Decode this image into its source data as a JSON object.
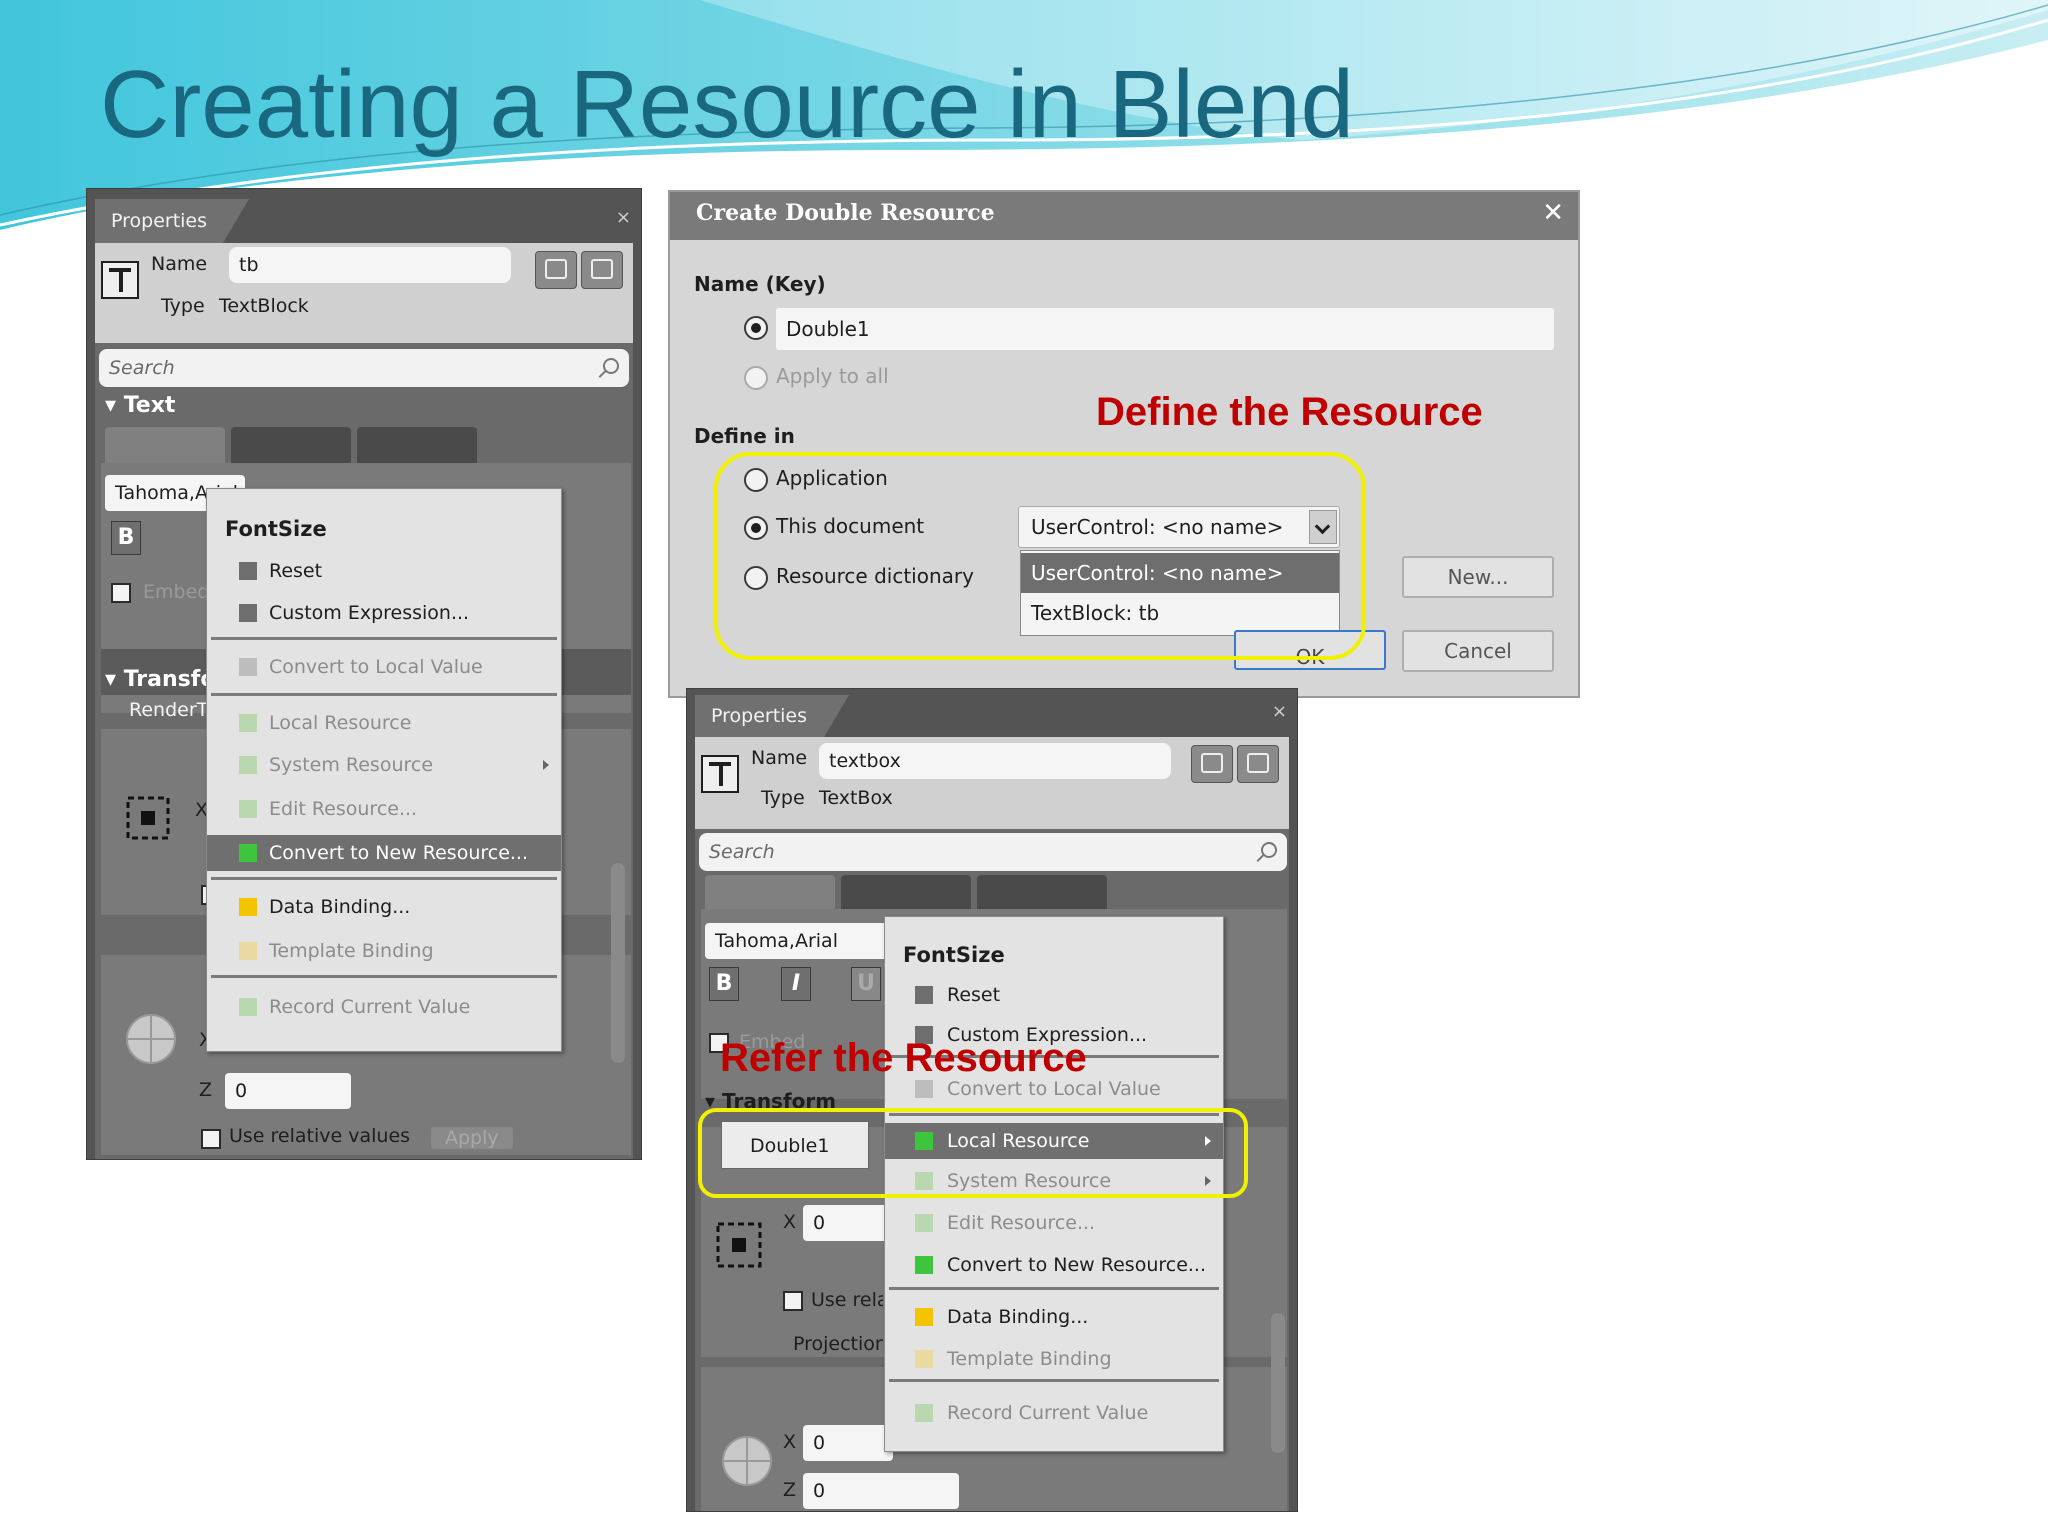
{
  "slide": {
    "title": "Creating a Resource in Blend"
  },
  "panel_left": {
    "tab": "Properties",
    "close": "×",
    "name_label": "Name",
    "name_value": "tb",
    "type_label": "Type",
    "type_value": "TextBlock",
    "search_placeholder": "Search",
    "section_text": "Text",
    "font_value": "Tahoma,Arial",
    "bold": "B",
    "embed": "Embed",
    "section_transform": "Transform",
    "render_label": "RenderTransform",
    "x_label": "X",
    "z_label": "Z",
    "z_value": "0",
    "use_relative": "Use relative values",
    "apply": "Apply"
  },
  "menu_left": {
    "header": "FontSize",
    "items": [
      {
        "label": "Reset",
        "color": "#6e6e6e",
        "enabled": true
      },
      {
        "label": "Custom Expression...",
        "color": "#6e6e6e",
        "enabled": true
      },
      {
        "label": "Convert to Local Value",
        "color": "#bdbdbd",
        "enabled": false
      },
      {
        "label": "Local Resource",
        "color": "#b9d8b0",
        "enabled": false
      },
      {
        "label": "System Resource",
        "color": "#b9d8b0",
        "enabled": false
      },
      {
        "label": "Edit Resource...",
        "color": "#b9d8b0",
        "enabled": false
      },
      {
        "label": "Convert to New Resource...",
        "color": "#3ec53e",
        "enabled": true
      },
      {
        "label": "Data Binding...",
        "color": "#f5c400",
        "enabled": true
      },
      {
        "label": "Template Binding",
        "color": "#ead9a0",
        "enabled": false
      },
      {
        "label": "Record Current Value",
        "color": "#b9d8b0",
        "enabled": false
      }
    ]
  },
  "dialog": {
    "title": "Create Double Resource",
    "close": "✕",
    "name_key_label": "Name (Key)",
    "name_value": "Double1",
    "apply_to_all": "Apply to all",
    "define_in_label": "Define in",
    "opt_application": "Application",
    "opt_this_document": "This document",
    "opt_resource_dictionary": "Resource dictionary",
    "combo_value": "UserControl: <no name>",
    "dropdown_items": [
      "UserControl: <no name>",
      "TextBlock: tb"
    ],
    "new_button": "New...",
    "ok_button": "OK",
    "cancel_button": "Cancel"
  },
  "annotations": {
    "define": "Define the Resource",
    "refer": "Refer the Resource",
    "color": "#c00000",
    "ring_color": "#f0f000"
  },
  "panel_right": {
    "tab": "Properties",
    "close": "×",
    "name_label": "Name",
    "name_value": "textbox",
    "type_label": "Type",
    "type_value": "TextBox",
    "search_placeholder": "Search",
    "font_value": "Tahoma,Arial",
    "bold": "B",
    "italic": "I",
    "underline": "U",
    "embed": "Embed",
    "section_transform": "Transform",
    "resource_tooltip": "Double1",
    "x_label": "X",
    "x_value": "0",
    "use_relative": "Use relative values",
    "projection": "Projection",
    "x2_value": "0",
    "z_label": "Z",
    "z_value": "0"
  },
  "menu_right": {
    "header": "FontSize",
    "items": [
      {
        "label": "Reset",
        "color": "#6e6e6e",
        "enabled": true
      },
      {
        "label": "Custom Expression...",
        "color": "#6e6e6e",
        "enabled": true
      },
      {
        "label": "Convert to Local Value",
        "color": "#bdbdbd",
        "enabled": false
      },
      {
        "label": "Local Resource",
        "color": "#3ec53e",
        "enabled": true
      },
      {
        "label": "System Resource",
        "color": "#b9d8b0",
        "enabled": false
      },
      {
        "label": "Edit Resource...",
        "color": "#b9d8b0",
        "enabled": false
      },
      {
        "label": "Convert to New Resource...",
        "color": "#3ec53e",
        "enabled": true
      },
      {
        "label": "Data Binding...",
        "color": "#f5c400",
        "enabled": true
      },
      {
        "label": "Template Binding",
        "color": "#ead9a0",
        "enabled": false
      },
      {
        "label": "Record Current Value",
        "color": "#b9d8b0",
        "enabled": false
      }
    ]
  }
}
